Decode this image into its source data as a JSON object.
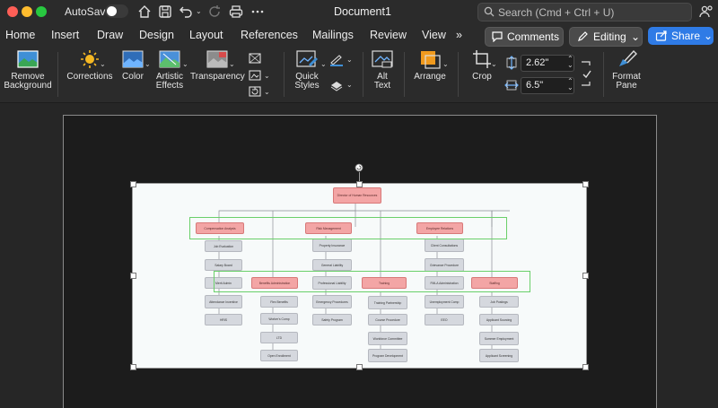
{
  "titlebar": {
    "autosave_label": "AutoSave",
    "document_title": "Document1",
    "search_placeholder": "Search (Cmd + Ctrl + U)"
  },
  "tabs": [
    "Home",
    "Insert",
    "Draw",
    "Design",
    "Layout",
    "References",
    "Mailings",
    "Review",
    "View"
  ],
  "tabs_overflow": "»",
  "buttons": {
    "comments": "Comments",
    "editing": "Editing",
    "share": "Share"
  },
  "ribbon": {
    "remove_bg_1": "Remove",
    "remove_bg_2": "Background",
    "corrections": "Corrections",
    "color": "Color",
    "artistic_1": "Artistic",
    "artistic_2": "Effects",
    "transparency": "Transparency",
    "quick_styles_1": "Quick",
    "quick_styles_2": "Styles",
    "alt_text_1": "Alt",
    "alt_text_2": "Text",
    "arrange": "Arrange",
    "crop": "Crop",
    "height_value": "2.62\"",
    "width_value": "6.5\"",
    "format_pane_1": "Format",
    "format_pane_2": "Pane"
  },
  "orgchart": {
    "root": "Director of Human Resources",
    "level1a": [
      "Compensation Analysis",
      "Risk Management",
      "Employee Relations"
    ],
    "level1b": [
      "Benefits Administration",
      "Training",
      "Staffing"
    ],
    "col_comp": [
      "Job Evaluation",
      "Salary Board",
      "Merit Admin",
      "Attendance Incentive",
      "HRIS"
    ],
    "col_benefits": [
      "Flex Benefits",
      "Worker's Comp",
      "LTD",
      "Open Enrollment"
    ],
    "col_risk": [
      "Property Insurance",
      "General Liability",
      "Professional Liability",
      "Emergency Procedures",
      "Safety Program"
    ],
    "col_training": [
      "Training Partnership",
      "Course Procedure",
      "Workforce Committee",
      "Program Development"
    ],
    "col_emp": [
      "Client Consultations",
      "Grievance Procedure",
      "FMLA Administration",
      "Unemployment Comp",
      "EEO"
    ],
    "col_staffing": [
      "Job Postings",
      "Applicant Sourcing",
      "Summer Employment",
      "Applicant Screening"
    ]
  },
  "colors": {
    "accent_share": "#2f7be6",
    "node_red": "#f3a5a5",
    "node_grey": "#d5d8de",
    "highlight_green": "#6ad06a"
  }
}
